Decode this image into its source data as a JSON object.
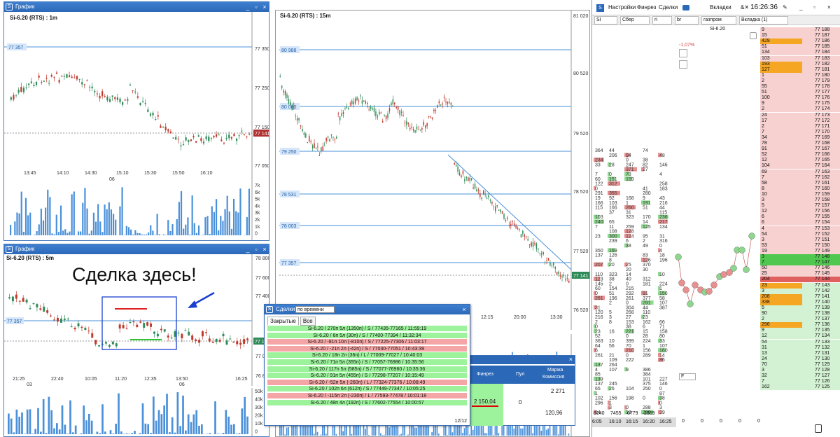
{
  "windows": {
    "chart1": {
      "title": "График",
      "label": "Si-6.20 (RTS) : 1m",
      "price_tag": "77 141",
      "level_tag": "77 357",
      "yticks": [
        "77 350",
        "77 250",
        "77 150",
        "77 050"
      ],
      "xticks": [
        "13:45",
        "14:10",
        "14:30",
        "15:10",
        "15:30",
        "15:50",
        "16:10"
      ],
      "date": "06",
      "vol_ticks": [
        "7k",
        "6k",
        "5k",
        "4k",
        "3k",
        "2k",
        "1k",
        "0"
      ]
    },
    "chart2": {
      "title": "График",
      "label": "Si-6.20 (RTS) : 5m",
      "price_tag": "77 14",
      "level_tag": "77 357",
      "yticks": [
        "78 800",
        "77 600",
        "77 400",
        "77 000",
        "76 80"
      ],
      "xticks": [
        "21:25",
        "22:40",
        "10:05",
        "11:20",
        "12:35",
        "13:50",
        "16:25"
      ],
      "dates": [
        "03",
        "06"
      ],
      "vol_ticks": [
        "50k",
        "40k",
        "30k",
        "20k",
        "10k",
        "0"
      ],
      "annotation": "Сделка здесь!"
    },
    "chart3": {
      "label": "Si-6.20 (RTS) : 15m",
      "price_tag": "77 141",
      "yticks": [
        "81 020",
        "80 520",
        "79 520",
        "78 520",
        "77 520",
        "76 520"
      ],
      "levels": [
        "80 988",
        "80 000",
        "79 250",
        "78 531",
        "78 003",
        "77 357"
      ],
      "xticks": [
        "12:15",
        "20:00",
        "13:30"
      ]
    }
  },
  "deals_dialog": {
    "title": "Сделки",
    "filter": "по времени",
    "tabs": [
      "Закрытые",
      "Все"
    ],
    "counter": "12/12",
    "rows": [
      {
        "text": "Si-6.20 / 270п 5л (1350п) / S / 77435-77165 / 11:59:19",
        "color": "g"
      },
      {
        "text": "Si-6.20 / 6п 5л (30п) / S / 77400-77394 / 11:32:34",
        "color": "g"
      },
      {
        "text": "Si-6.20 / -81п 10л (-810п) / S / 77225-77306 / 11:03:17",
        "color": "r"
      },
      {
        "text": "Si-6.20 / -21п 2л (-42п) / S / 77030-77051 / 10:43:39",
        "color": "r"
      },
      {
        "text": "Si-6.20 / 18п 2л (36п) / L / 77009-77027 / 10:40:03",
        "color": "g"
      },
      {
        "text": "Si-6.20 / 71п 5л (355п) / S / 77057-76986 / 10:35:56",
        "color": "g"
      },
      {
        "text": "Si-6.20 / 117п 5л (585п) / S / 77077-76960 / 10:35:36",
        "color": "g"
      },
      {
        "text": "Si-6.20 / 91п 5л (455п) / S / 77298-77207 / 10:15:49",
        "color": "g"
      },
      {
        "text": "Si-6.20 / -52п 5л (-260п) / L / 77324-77376 / 10:08:49",
        "color": "r"
      },
      {
        "text": "Si-6.20 / 102п 6л (612п) / S / 77449-77347 / 10:05:25",
        "color": "g"
      },
      {
        "text": "Si-6.20 / -115п 2л (-230п) / L / 77593-77478 / 10:01:18",
        "color": "r"
      },
      {
        "text": "Si-6.20 / 48п 4л (192п) / S / 77602-77554 / 10:00:57",
        "color": "g"
      }
    ]
  },
  "finpanel": {
    "col1": "Финрез",
    "col2": "Пул",
    "col3": "Маржа",
    "col3b": "Комиссия",
    "value1": "2 150,04",
    "value2": "0",
    "value3": "2 271",
    "value4": "120,96"
  },
  "terminal": {
    "menu": [
      "Настройки",
      "Финрез",
      "Сделки",
      "Вкладки"
    ],
    "clock": "16:26:36",
    "tabs": [
      "SI",
      "Сбер",
      "ri",
      "br",
      "газпром",
      "Вкладка (1)"
    ],
    "instrument": "Si-6.20",
    "change": "-1,07%",
    "book_qty": [
      "9",
      "15",
      "429",
      "51",
      "134",
      "103",
      "193",
      "127",
      "1",
      "2",
      "55",
      "51",
      "100",
      "9",
      "2",
      "24",
      "17",
      "2",
      "7",
      "34",
      "78",
      "91",
      "52",
      "12",
      "104",
      "69",
      "7",
      "58",
      "8",
      "10",
      "3",
      "5",
      "12",
      "6",
      "6",
      "4",
      "54",
      "3",
      "53",
      "19",
      "3",
      "7",
      "50",
      "25",
      "204",
      "23",
      "3",
      "208",
      "338",
      "5",
      "90",
      "2",
      "296",
      "9",
      "12",
      "54",
      "31",
      "13",
      "24",
      "70",
      "3",
      "32",
      "7",
      "162"
    ],
    "book_prices": [
      "77 188",
      "77 187",
      "77 186",
      "77 185",
      "77 184",
      "77 183",
      "77 182",
      "77 181",
      "77 180",
      "77 179",
      "77 178",
      "77 177",
      "77 176",
      "77 175",
      "77 174",
      "77 173",
      "77 172",
      "77 171",
      "77 170",
      "77 169",
      "77 168",
      "77 167",
      "77 166",
      "77 165",
      "77 164",
      "77 163",
      "77 162",
      "77 161",
      "77 160",
      "77 159",
      "77 158",
      "77 157",
      "77 156",
      "77 155",
      "77 154",
      "77 153",
      "77 152",
      "77 151",
      "77 150",
      "77 149",
      "77 148",
      "77 147",
      "77 146",
      "77 145",
      "77 144",
      "77 143",
      "77 142",
      "77 141",
      "77 140",
      "77 139",
      "77 138",
      "77 137",
      "77 136",
      "77 135",
      "77 134",
      "77 133",
      "77 132",
      "77 131",
      "77 130",
      "77 129",
      "77 128",
      "77 127",
      "77 126",
      "77 125"
    ],
    "time_ticks": [
      "6:05",
      "16:10",
      "16:15",
      "16:20",
      "16:25"
    ],
    "bottom_values": [
      "8140",
      "7455",
      "6779",
      "2559"
    ],
    "zero_row": [
      "0",
      "0",
      "0",
      "0",
      "0"
    ],
    "f_label": "F"
  },
  "colors": {
    "accent": "#2c68b8",
    "bull": "#2e8b57",
    "bear": "#c0392b",
    "level": "#4a90d9",
    "green_row": "#9cf39c",
    "red_row": "#f4a6a6"
  }
}
